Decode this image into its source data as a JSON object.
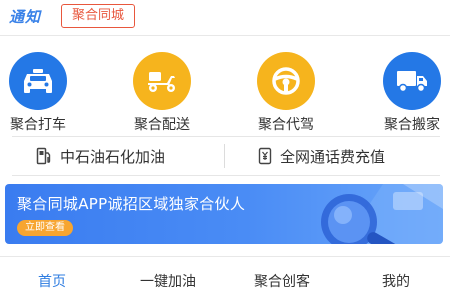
{
  "notice": {
    "title": "通知",
    "tag": "聚合同城"
  },
  "services": [
    {
      "label": "聚合打车",
      "icon": "car-icon",
      "color": "#2478e6"
    },
    {
      "label": "聚合配送",
      "icon": "scooter-icon",
      "color": "#f6b41d"
    },
    {
      "label": "聚合代驾",
      "icon": "steering-wheel-icon",
      "color": "#f6b41d"
    },
    {
      "label": "聚合搬家",
      "icon": "truck-icon",
      "color": "#2478e6"
    }
  ],
  "quick_links": [
    {
      "label": "中石油石化加油",
      "icon": "fuel-pump-icon"
    },
    {
      "label": "全网通话费充值",
      "icon": "yuan-phone-icon"
    }
  ],
  "banner": {
    "text": "聚合同城APP诚招区域独家合伙人",
    "button": "立即查看",
    "colors": {
      "start": "#3a7cf0",
      "end": "#6aa6fa",
      "button": "#f7a530"
    }
  },
  "bottom_nav": {
    "active_color": "#2f7de1",
    "tabs": [
      {
        "label": "首页",
        "active": true
      },
      {
        "label": "一键加油",
        "active": false
      },
      {
        "label": "聚合创客",
        "active": false
      },
      {
        "label": "我的",
        "active": false
      }
    ]
  }
}
